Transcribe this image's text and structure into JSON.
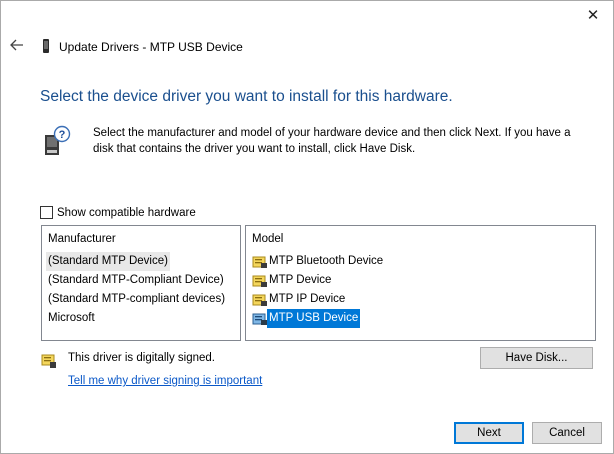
{
  "window": {
    "title": "Update Drivers - MTP USB Device",
    "close_glyph": "✕"
  },
  "heading": "Select the device driver you want to install for this hardware.",
  "info": {
    "text": "Select the manufacturer and model of your hardware device and then click Next. If you have a disk that contains the driver you want to install, click Have Disk.",
    "icon": "hardware-question-icon"
  },
  "compat": {
    "label": "Show compatible hardware",
    "checked": false
  },
  "manufacturer": {
    "header": "Manufacturer",
    "items": [
      {
        "label": "(Standard MTP Device)",
        "state": "focused"
      },
      {
        "label": "(Standard MTP-Compliant Device)",
        "state": "normal"
      },
      {
        "label": "(Standard MTP-compliant devices)",
        "state": "normal"
      },
      {
        "label": "Microsoft",
        "state": "normal"
      }
    ]
  },
  "model": {
    "header": "Model",
    "items": [
      {
        "label": "MTP Bluetooth Device",
        "state": "normal"
      },
      {
        "label": "MTP Device",
        "state": "normal"
      },
      {
        "label": "MTP IP Device",
        "state": "normal"
      },
      {
        "label": "MTP USB Device",
        "state": "selected"
      }
    ]
  },
  "signing": {
    "status": "This driver is digitally signed.",
    "link": "Tell me why driver signing is important"
  },
  "buttons": {
    "have_disk": "Have Disk...",
    "next": "Next",
    "cancel": "Cancel"
  },
  "colors": {
    "heading": "#1a4f8e",
    "selection": "#0078d7",
    "link": "#0a58c8"
  }
}
